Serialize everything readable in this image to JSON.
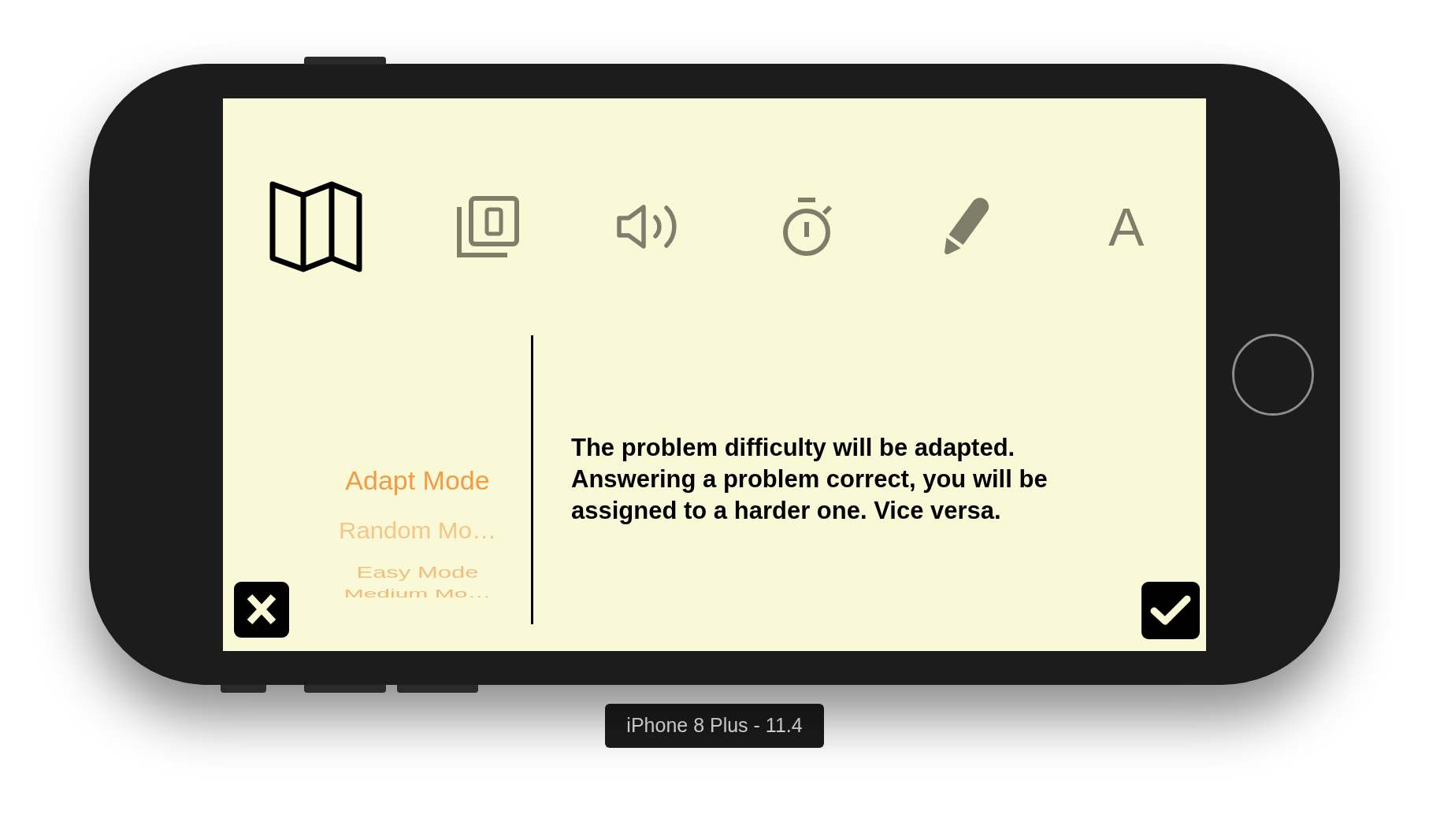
{
  "toolbar": {
    "tabs": [
      {
        "kind": "map",
        "selected": true
      },
      {
        "kind": "squares",
        "selected": false
      },
      {
        "kind": "speaker",
        "selected": false
      },
      {
        "kind": "stopwatch",
        "selected": false
      },
      {
        "kind": "pencil",
        "selected": false
      },
      {
        "kind": "letter",
        "label": "A",
        "selected": false
      }
    ]
  },
  "mode_picker": {
    "items": [
      {
        "label": "Adapt Mode",
        "selected": true
      },
      {
        "label": "Random Mo…",
        "selected": false
      },
      {
        "label": "Easy Mode",
        "selected": false
      },
      {
        "label": "Medium Mo…",
        "selected": false
      }
    ]
  },
  "description": "The problem difficulty will be adapted. Answering a problem correct, you will be assigned to a harder one. Vice versa.",
  "device_label": "iPhone 8 Plus - 11.4"
}
